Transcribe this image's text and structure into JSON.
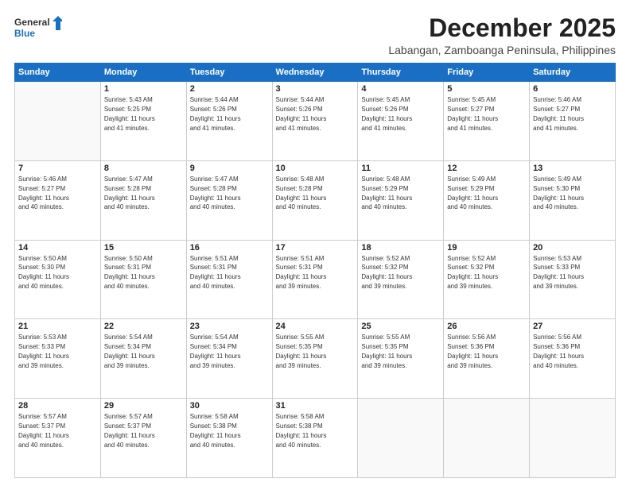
{
  "logo": {
    "general": "General",
    "blue": "Blue"
  },
  "header": {
    "month": "December 2025",
    "location": "Labangan, Zamboanga Peninsula, Philippines"
  },
  "days": [
    "Sunday",
    "Monday",
    "Tuesday",
    "Wednesday",
    "Thursday",
    "Friday",
    "Saturday"
  ],
  "weeks": [
    [
      {
        "day": "",
        "sunrise": "",
        "sunset": "",
        "daylight": ""
      },
      {
        "day": "1",
        "sunrise": "Sunrise: 5:43 AM",
        "sunset": "Sunset: 5:25 PM",
        "daylight": "Daylight: 11 hours and 41 minutes."
      },
      {
        "day": "2",
        "sunrise": "Sunrise: 5:44 AM",
        "sunset": "Sunset: 5:26 PM",
        "daylight": "Daylight: 11 hours and 41 minutes."
      },
      {
        "day": "3",
        "sunrise": "Sunrise: 5:44 AM",
        "sunset": "Sunset: 5:26 PM",
        "daylight": "Daylight: 11 hours and 41 minutes."
      },
      {
        "day": "4",
        "sunrise": "Sunrise: 5:45 AM",
        "sunset": "Sunset: 5:26 PM",
        "daylight": "Daylight: 11 hours and 41 minutes."
      },
      {
        "day": "5",
        "sunrise": "Sunrise: 5:45 AM",
        "sunset": "Sunset: 5:27 PM",
        "daylight": "Daylight: 11 hours and 41 minutes."
      },
      {
        "day": "6",
        "sunrise": "Sunrise: 5:46 AM",
        "sunset": "Sunset: 5:27 PM",
        "daylight": "Daylight: 11 hours and 41 minutes."
      }
    ],
    [
      {
        "day": "7",
        "sunrise": "Sunrise: 5:46 AM",
        "sunset": "Sunset: 5:27 PM",
        "daylight": "Daylight: 11 hours and 40 minutes."
      },
      {
        "day": "8",
        "sunrise": "Sunrise: 5:47 AM",
        "sunset": "Sunset: 5:28 PM",
        "daylight": "Daylight: 11 hours and 40 minutes."
      },
      {
        "day": "9",
        "sunrise": "Sunrise: 5:47 AM",
        "sunset": "Sunset: 5:28 PM",
        "daylight": "Daylight: 11 hours and 40 minutes."
      },
      {
        "day": "10",
        "sunrise": "Sunrise: 5:48 AM",
        "sunset": "Sunset: 5:28 PM",
        "daylight": "Daylight: 11 hours and 40 minutes."
      },
      {
        "day": "11",
        "sunrise": "Sunrise: 5:48 AM",
        "sunset": "Sunset: 5:29 PM",
        "daylight": "Daylight: 11 hours and 40 minutes."
      },
      {
        "day": "12",
        "sunrise": "Sunrise: 5:49 AM",
        "sunset": "Sunset: 5:29 PM",
        "daylight": "Daylight: 11 hours and 40 minutes."
      },
      {
        "day": "13",
        "sunrise": "Sunrise: 5:49 AM",
        "sunset": "Sunset: 5:30 PM",
        "daylight": "Daylight: 11 hours and 40 minutes."
      }
    ],
    [
      {
        "day": "14",
        "sunrise": "Sunrise: 5:50 AM",
        "sunset": "Sunset: 5:30 PM",
        "daylight": "Daylight: 11 hours and 40 minutes."
      },
      {
        "day": "15",
        "sunrise": "Sunrise: 5:50 AM",
        "sunset": "Sunset: 5:31 PM",
        "daylight": "Daylight: 11 hours and 40 minutes."
      },
      {
        "day": "16",
        "sunrise": "Sunrise: 5:51 AM",
        "sunset": "Sunset: 5:31 PM",
        "daylight": "Daylight: 11 hours and 40 minutes."
      },
      {
        "day": "17",
        "sunrise": "Sunrise: 5:51 AM",
        "sunset": "Sunset: 5:31 PM",
        "daylight": "Daylight: 11 hours and 39 minutes."
      },
      {
        "day": "18",
        "sunrise": "Sunrise: 5:52 AM",
        "sunset": "Sunset: 5:32 PM",
        "daylight": "Daylight: 11 hours and 39 minutes."
      },
      {
        "day": "19",
        "sunrise": "Sunrise: 5:52 AM",
        "sunset": "Sunset: 5:32 PM",
        "daylight": "Daylight: 11 hours and 39 minutes."
      },
      {
        "day": "20",
        "sunrise": "Sunrise: 5:53 AM",
        "sunset": "Sunset: 5:33 PM",
        "daylight": "Daylight: 11 hours and 39 minutes."
      }
    ],
    [
      {
        "day": "21",
        "sunrise": "Sunrise: 5:53 AM",
        "sunset": "Sunset: 5:33 PM",
        "daylight": "Daylight: 11 hours and 39 minutes."
      },
      {
        "day": "22",
        "sunrise": "Sunrise: 5:54 AM",
        "sunset": "Sunset: 5:34 PM",
        "daylight": "Daylight: 11 hours and 39 minutes."
      },
      {
        "day": "23",
        "sunrise": "Sunrise: 5:54 AM",
        "sunset": "Sunset: 5:34 PM",
        "daylight": "Daylight: 11 hours and 39 minutes."
      },
      {
        "day": "24",
        "sunrise": "Sunrise: 5:55 AM",
        "sunset": "Sunset: 5:35 PM",
        "daylight": "Daylight: 11 hours and 39 minutes."
      },
      {
        "day": "25",
        "sunrise": "Sunrise: 5:55 AM",
        "sunset": "Sunset: 5:35 PM",
        "daylight": "Daylight: 11 hours and 39 minutes."
      },
      {
        "day": "26",
        "sunrise": "Sunrise: 5:56 AM",
        "sunset": "Sunset: 5:36 PM",
        "daylight": "Daylight: 11 hours and 39 minutes."
      },
      {
        "day": "27",
        "sunrise": "Sunrise: 5:56 AM",
        "sunset": "Sunset: 5:36 PM",
        "daylight": "Daylight: 11 hours and 40 minutes."
      }
    ],
    [
      {
        "day": "28",
        "sunrise": "Sunrise: 5:57 AM",
        "sunset": "Sunset: 5:37 PM",
        "daylight": "Daylight: 11 hours and 40 minutes."
      },
      {
        "day": "29",
        "sunrise": "Sunrise: 5:57 AM",
        "sunset": "Sunset: 5:37 PM",
        "daylight": "Daylight: 11 hours and 40 minutes."
      },
      {
        "day": "30",
        "sunrise": "Sunrise: 5:58 AM",
        "sunset": "Sunset: 5:38 PM",
        "daylight": "Daylight: 11 hours and 40 minutes."
      },
      {
        "day": "31",
        "sunrise": "Sunrise: 5:58 AM",
        "sunset": "Sunset: 5:38 PM",
        "daylight": "Daylight: 11 hours and 40 minutes."
      },
      {
        "day": "",
        "sunrise": "",
        "sunset": "",
        "daylight": ""
      },
      {
        "day": "",
        "sunrise": "",
        "sunset": "",
        "daylight": ""
      },
      {
        "day": "",
        "sunrise": "",
        "sunset": "",
        "daylight": ""
      }
    ]
  ]
}
